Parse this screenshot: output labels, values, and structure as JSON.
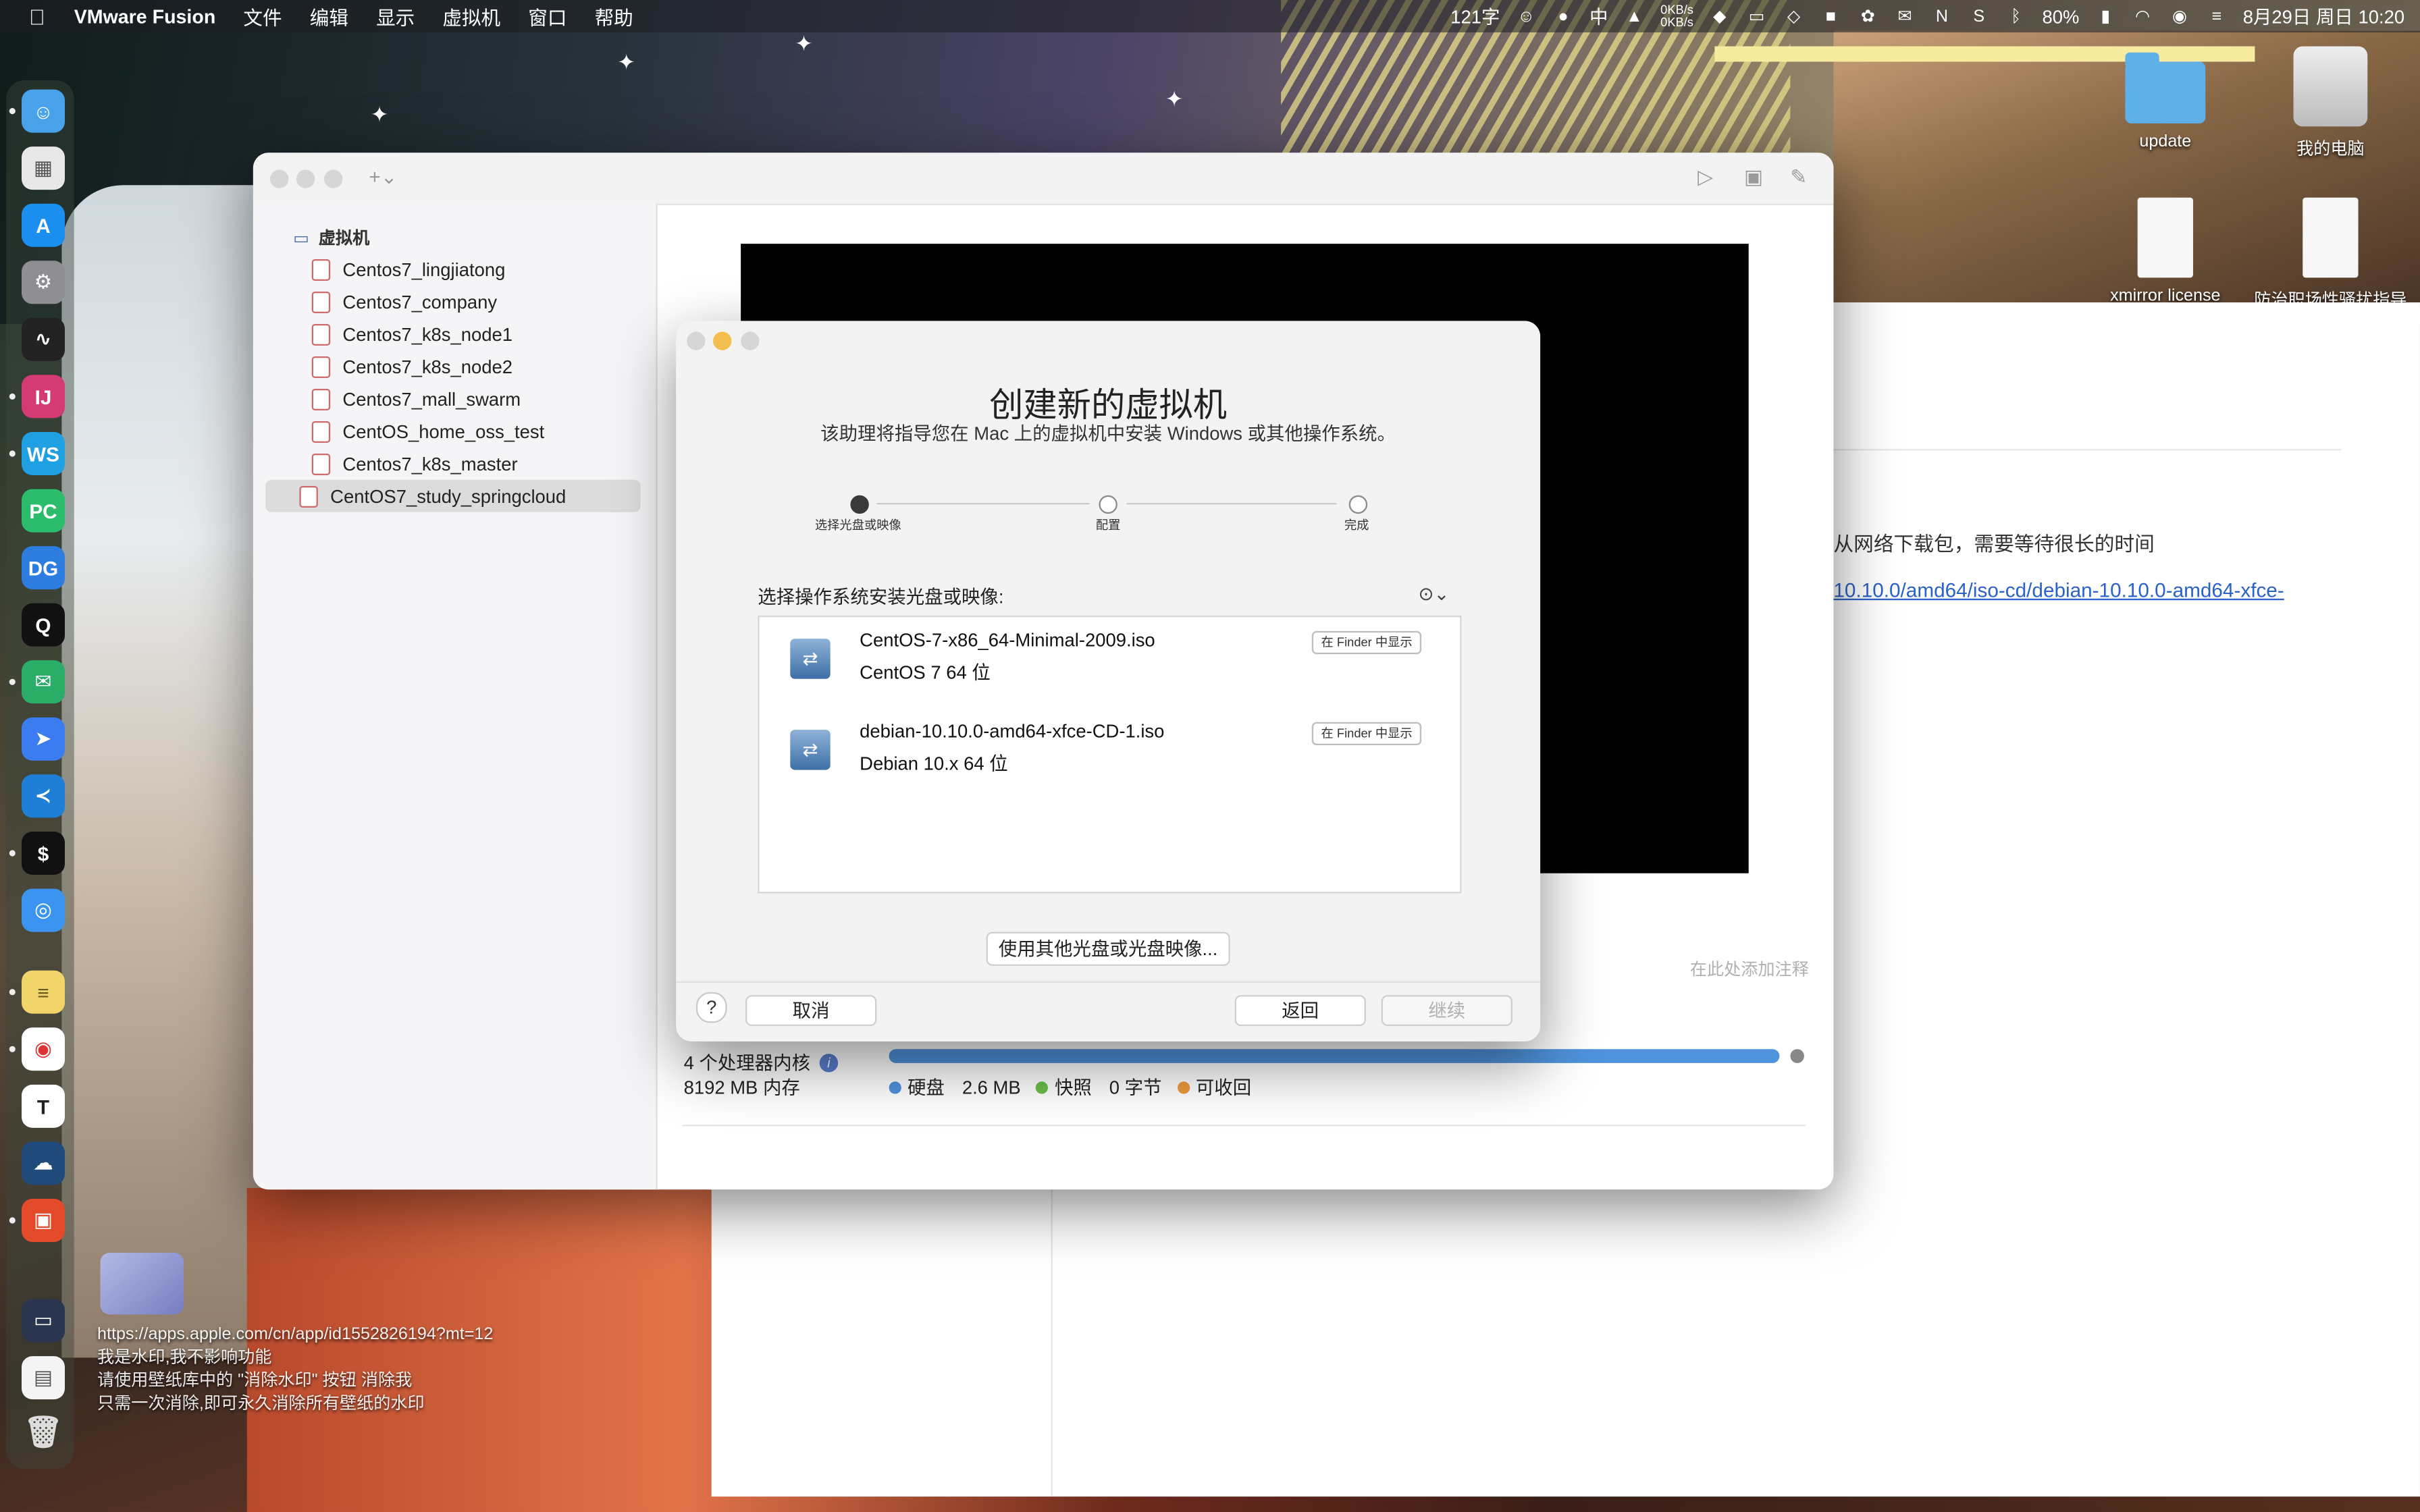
{
  "menubar": {
    "app_name": "VMware Fusion",
    "menus": [
      "文件",
      "编辑",
      "显示",
      "虚拟机",
      "窗口",
      "帮助"
    ],
    "word_count": "121字",
    "input_method": "中",
    "net_up": "0KB/s",
    "net_down": "0KB/s",
    "battery": "80%",
    "datetime": "8月29日 周日 10:20"
  },
  "desktop": {
    "items": [
      {
        "label": "update",
        "kind": "folder"
      },
      {
        "label": "我的电脑",
        "kind": "hdd"
      },
      {
        "label": "xmirror license",
        "kind": "doc"
      },
      {
        "label": "防治职场性骚扰指导",
        "kind": "doc"
      }
    ]
  },
  "dock": {
    "apps": [
      "finder",
      "launchpad",
      "app-store",
      "system-preferences",
      "activity-monitor",
      "intellij",
      "webstorm",
      "pycharm",
      "datagrip",
      "qq",
      "wechat",
      "feishu",
      "vscode",
      "terminal",
      "safari",
      "notes",
      "chrome",
      "typora",
      "baidu-netdisk",
      "vmware-fusion",
      "screen-capture",
      "preview",
      "trash"
    ]
  },
  "vmware": {
    "sidebar": {
      "group_label": "虚拟机",
      "items": [
        {
          "label": "Centos7_lingjiatong"
        },
        {
          "label": "Centos7_company"
        },
        {
          "label": "Centos7_k8s_node1"
        },
        {
          "label": "Centos7_k8s_node2"
        },
        {
          "label": "Centos7_mall_swarm"
        },
        {
          "label": "CentOS_home_oss_test"
        },
        {
          "label": "Centos7_k8s_master"
        },
        {
          "label": "CentOS7_study_springcloud",
          "selected": true
        }
      ]
    },
    "notes_placeholder": "在此处添加注释",
    "cpu": "4 个处理器内核",
    "memory": "8192 MB 内存",
    "storage": {
      "disk_label": "硬盘",
      "disk_value": "2.6 MB",
      "snapshot_label": "快照",
      "snapshot_value": "0 字节",
      "reclaim_label": "可收回",
      "colors": {
        "disk": "#4f93dc",
        "snapshot": "#6bbf4a",
        "reclaim": "#f09a3c"
      }
    }
  },
  "background_doc": {
    "text": "从网络下载包，需要等待很长的时间",
    "link": "10.10.0/amd64/iso-cd/debian-10.10.0-amd64-xfce-"
  },
  "dialog": {
    "title": "创建新的虚拟机",
    "subtitle": "该助理将指导您在 Mac 上的虚拟机中安装 Windows 或其他操作系统。",
    "steps": [
      "选择光盘或映像",
      "配置",
      "完成"
    ],
    "current_step": 0,
    "list_label": "选择操作系统安装光盘或映像:",
    "isos": [
      {
        "name": "CentOS-7-x86_64-Minimal-2009.iso",
        "os": "CentOS 7 64 位",
        "finder_label": "在 Finder 中显示"
      },
      {
        "name": "debian-10.10.0-amd64-xfce-CD-1.iso",
        "os": "Debian 10.x 64 位",
        "finder_label": "在 Finder 中显示"
      }
    ],
    "other_button": "使用其他光盘或光盘映像...",
    "help": "?",
    "cancel": "取消",
    "back": "返回",
    "continue": "继续"
  },
  "watermark": {
    "lines": [
      "https://apps.apple.com/cn/app/id1552826194?mt=12",
      "我是水印,我不影响功能",
      "请使用壁纸库中的 \"消除水印\" 按钮 消除我",
      "只需一次消除,即可永久消除所有壁纸的水印"
    ]
  }
}
